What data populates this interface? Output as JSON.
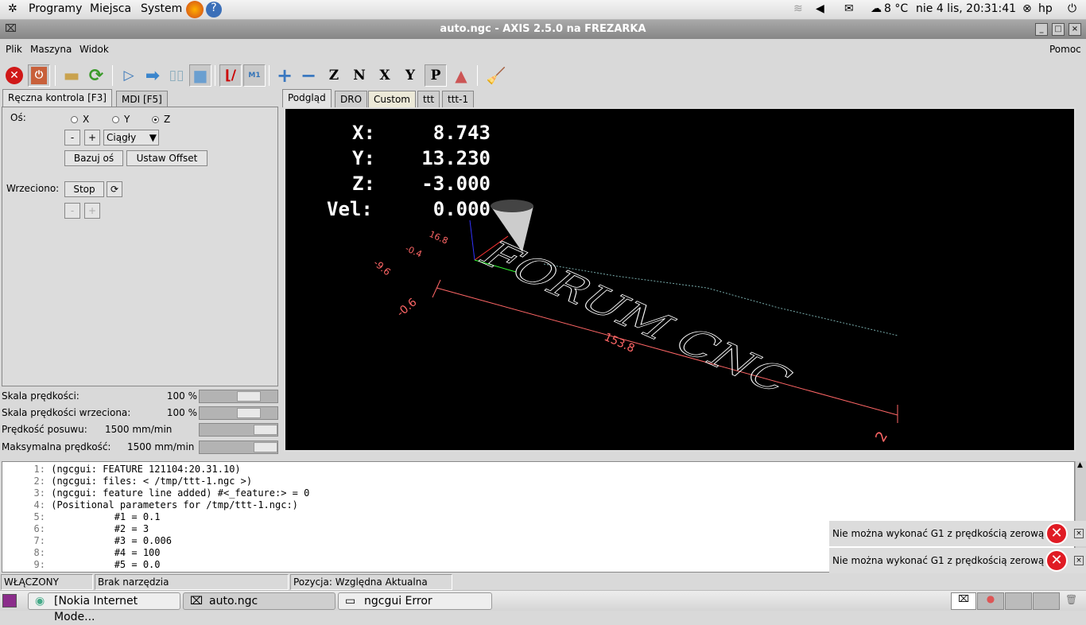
{
  "top_panel": {
    "menus": [
      "Programy",
      "Miejsca",
      "System"
    ],
    "weather": "8 °C",
    "clock": "nie  4 lis, 20:31:41",
    "user": "hp"
  },
  "window": {
    "title": "auto.ngc - AXIS 2.5.0 na FREZARKA"
  },
  "menu": {
    "items": [
      "Plik",
      "Maszyna",
      "Widok"
    ],
    "help": "Pomoc"
  },
  "toolbar": {
    "z": "Z",
    "n": "N",
    "x": "X",
    "y": "Y",
    "p": "P",
    "m1": "M1"
  },
  "left_tabs": [
    "Ręczna kontrola [F3]",
    "MDI [F5]"
  ],
  "manual": {
    "axis_label": "Oś:",
    "axes": [
      "X",
      "Y",
      "Z"
    ],
    "selected_axis": "Z",
    "minus": "-",
    "plus": "+",
    "jog_mode": "Ciągły",
    "home_button": "Bazuj oś",
    "offset_button": "Ustaw Offset",
    "spindle_label": "Wrzeciono:",
    "spindle_stop": "Stop"
  },
  "sliders": [
    {
      "label": "Skala prędkości:",
      "value": "100 %",
      "fraction": 0.8
    },
    {
      "label": "Skala prędkości wrzeciona:",
      "value": "100 %",
      "fraction": 0.8
    },
    {
      "label": "Prędkość posuwu:",
      "value": "1500 mm/min",
      "fraction": 1.0
    },
    {
      "label": "Maksymalna prędkość:",
      "value": "1500 mm/min",
      "fraction": 1.0
    }
  ],
  "preview_tabs": [
    "Podgląd",
    "DRO",
    "Custom",
    "ttt",
    "ttt-1"
  ],
  "dro": [
    {
      "axis": "X:",
      "value": "8.743"
    },
    {
      "axis": "Y:",
      "value": "13.230"
    },
    {
      "axis": "Z:",
      "value": "-3.000"
    },
    {
      "axis": "Vel:",
      "value": "0.000"
    }
  ],
  "preview": {
    "engraving_text": "FORUM CNC",
    "dim_length": "153.8",
    "dim_y": "-0.6",
    "dim_a": "16.8",
    "dim_b": "-0.4",
    "dim_c": "-9.6",
    "dim_z": "2"
  },
  "code_lines": [
    {
      "n": "1:",
      "text": "(ngcgui: FEATURE 121104:20.31.10)"
    },
    {
      "n": "2:",
      "text": "(ngcgui: files: < /tmp/ttt-1.ngc >)"
    },
    {
      "n": "3:",
      "text": "(ngcgui: feature line added) #<_feature:> = 0"
    },
    {
      "n": "4:",
      "text": "(Positional parameters for /tmp/ttt-1.ngc:)"
    },
    {
      "n": "5:",
      "text": "           #1 = 0.1"
    },
    {
      "n": "6:",
      "text": "           #2 = 3"
    },
    {
      "n": "7:",
      "text": "           #3 = 0.006"
    },
    {
      "n": "8:",
      "text": "           #4 = 100"
    },
    {
      "n": "9:",
      "text": "           #5 = 0.0"
    }
  ],
  "notifications": [
    "Nie można wykonać G1 z prędkością zerową",
    "Nie można wykonać G1 z prędkością zerową"
  ],
  "status": {
    "state": "WŁĄCZONY",
    "tool": "Brak narzędzia",
    "position": "Pozycja: Względna Aktualna"
  },
  "taskbar": [
    "[Nokia Internet Mode...",
    "auto.ngc",
    "ngcgui Error"
  ]
}
